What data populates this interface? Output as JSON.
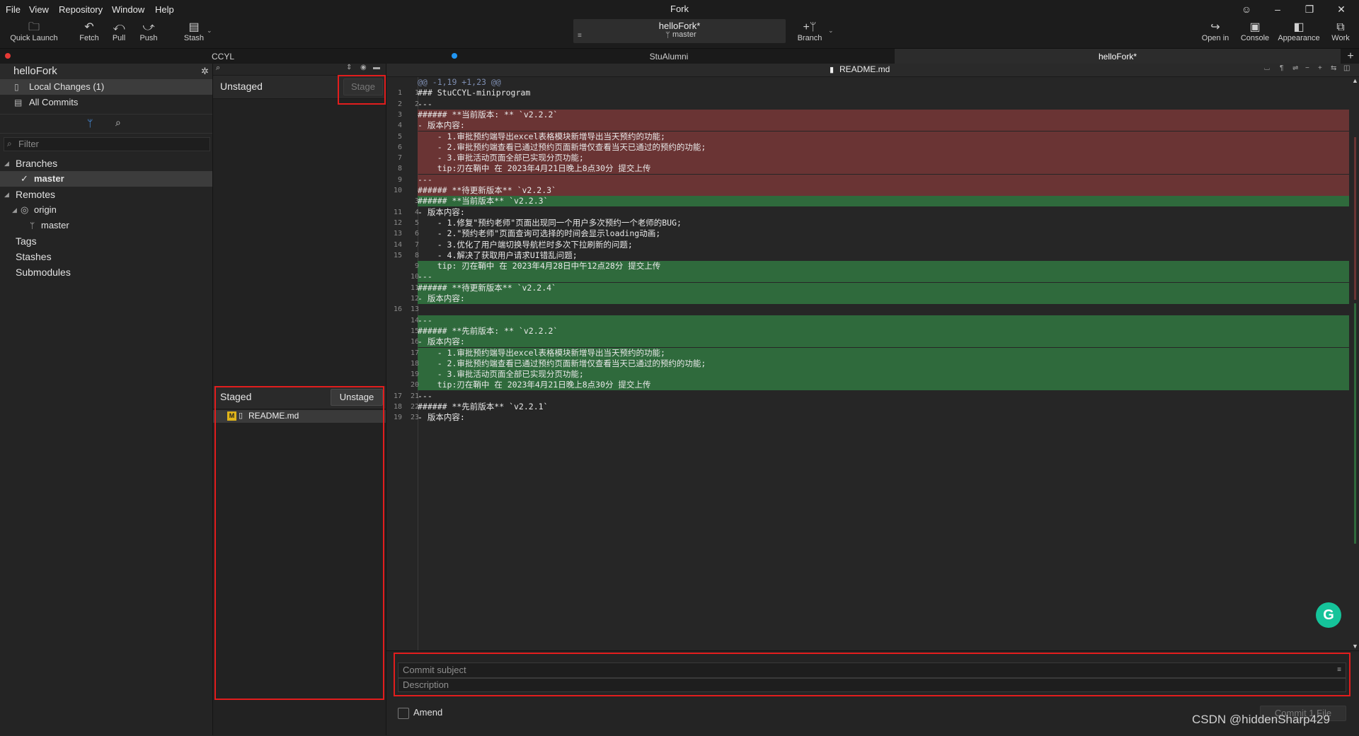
{
  "menu": [
    "File",
    "View",
    "Repository",
    "Window",
    "Help"
  ],
  "app_title": "Fork",
  "toolbar": {
    "quick_launch": "Quick Launch",
    "fetch": "Fetch",
    "pull": "Pull",
    "push": "Push",
    "stash": "Stash",
    "branch": "Branch",
    "open_in": "Open in",
    "console": "Console",
    "appearance": "Appearance",
    "work": "Work"
  },
  "repo_chip": {
    "repo": "helloFork*",
    "branch": "master"
  },
  "tabs": [
    {
      "label": "CCYL"
    },
    {
      "label": "StuAlumni"
    },
    {
      "label": "helloFork*"
    }
  ],
  "sidebar": {
    "repo_name": "helloFork",
    "local_changes": "Local Changes (1)",
    "all_commits": "All Commits",
    "filter_placeholder": "Filter",
    "branches": "Branches",
    "branch_master": "master",
    "remotes": "Remotes",
    "origin": "origin",
    "origin_master": "master",
    "tags": "Tags",
    "stashes": "Stashes",
    "submodules": "Submodules"
  },
  "files": {
    "unstaged_title": "Unstaged",
    "stage_button": "Stage",
    "staged_title": "Staged",
    "unstage_button": "Unstage",
    "staged_file": "README.md",
    "staged_file_badge": "M"
  },
  "diff": {
    "filename": "README.md",
    "lines": [
      {
        "type": "hunk",
        "n1": "",
        "n2": "",
        "text": "@@ -1,19 +1,23 @@"
      },
      {
        "type": "ctx",
        "n1": "1",
        "n2": "1",
        "text": "### StuCCYL-miniprogram"
      },
      {
        "type": "ctx",
        "n1": "2",
        "n2": "2",
        "text": "---"
      },
      {
        "type": "del",
        "n1": "3",
        "n2": "",
        "text": "###### **当前版本: ** `v2.2.2`"
      },
      {
        "type": "del",
        "n1": "4",
        "n2": "",
        "text": "- 版本内容:"
      },
      {
        "type": "del",
        "n1": "5",
        "n2": "",
        "text": "    - 1.审批预约端导出excel表格模块新增导出当天预约的功能;"
      },
      {
        "type": "del",
        "n1": "6",
        "n2": "",
        "text": "    - 2.审批预约端查看已通过预约页面新增仅查看当天已通过的预约的功能;"
      },
      {
        "type": "del",
        "n1": "7",
        "n2": "",
        "text": "    - 3.审批活动页面全部已实现分页功能;"
      },
      {
        "type": "del",
        "n1": "8",
        "n2": "",
        "text": "    tip:刃在鞘中 在 2023年4月21日晚上8点30分 提交上传"
      },
      {
        "type": "del",
        "n1": "9",
        "n2": "",
        "text": "---"
      },
      {
        "type": "del",
        "n1": "10",
        "n2": "",
        "text": "###### **待更新版本** `v2.2.3`"
      },
      {
        "type": "add",
        "n1": "",
        "n2": "3",
        "text": "###### **当前版本** `v2.2.3`"
      },
      {
        "type": "ctx",
        "n1": "11",
        "n2": "4",
        "text": "- 版本内容:"
      },
      {
        "type": "ctx",
        "n1": "12",
        "n2": "5",
        "text": "    - 1.修复\"预约老师\"页面出现同一个用户多次预约一个老师的BUG;"
      },
      {
        "type": "ctx",
        "n1": "13",
        "n2": "6",
        "text": "    - 2.\"预约老师\"页面查询可选择的时间会显示loading动画;"
      },
      {
        "type": "ctx",
        "n1": "14",
        "n2": "7",
        "text": "    - 3.优化了用户端切换导航栏时多次下拉刷新的问题;"
      },
      {
        "type": "ctx",
        "n1": "15",
        "n2": "8",
        "text": "    - 4.解决了获取用户请求UI错乱问题;"
      },
      {
        "type": "add",
        "n1": "",
        "n2": "9",
        "text": "    tip: 刃在鞘中 在 2023年4月28日中午12点28分 提交上传"
      },
      {
        "type": "add",
        "n1": "",
        "n2": "10",
        "text": "---"
      },
      {
        "type": "add",
        "n1": "",
        "n2": "11",
        "text": "###### **待更新版本** `v2.2.4`"
      },
      {
        "type": "add",
        "n1": "",
        "n2": "12",
        "text": "- 版本内容:"
      },
      {
        "type": "ctx",
        "n1": "16",
        "n2": "13",
        "text": ""
      },
      {
        "type": "add",
        "n1": "",
        "n2": "14",
        "text": "---"
      },
      {
        "type": "add",
        "n1": "",
        "n2": "15",
        "text": "###### **先前版本: ** `v2.2.2`"
      },
      {
        "type": "add",
        "n1": "",
        "n2": "16",
        "text": "- 版本内容:"
      },
      {
        "type": "add",
        "n1": "",
        "n2": "17",
        "text": "    - 1.审批预约端导出excel表格模块新增导出当天预约的功能;"
      },
      {
        "type": "add",
        "n1": "",
        "n2": "18",
        "text": "    - 2.审批预约端查看已通过预约页面新增仅查看当天已通过的预约的功能;"
      },
      {
        "type": "add",
        "n1": "",
        "n2": "19",
        "text": "    - 3.审批活动页面全部已实现分页功能;"
      },
      {
        "type": "add",
        "n1": "",
        "n2": "20",
        "text": "    tip:刃在鞘中 在 2023年4月21日晚上8点30分 提交上传"
      },
      {
        "type": "ctx",
        "n1": "17",
        "n2": "21",
        "text": "---"
      },
      {
        "type": "ctx",
        "n1": "18",
        "n2": "22",
        "text": "###### **先前版本** `v2.2.1`"
      },
      {
        "type": "ctx",
        "n1": "19",
        "n2": "23",
        "text": "- 版本内容:"
      }
    ]
  },
  "commit": {
    "subject_placeholder": "Commit subject",
    "description_placeholder": "Description",
    "amend_label": "Amend",
    "commit_button": "Commit 1 File"
  },
  "watermark": "CSDN @hiddenSharp429"
}
